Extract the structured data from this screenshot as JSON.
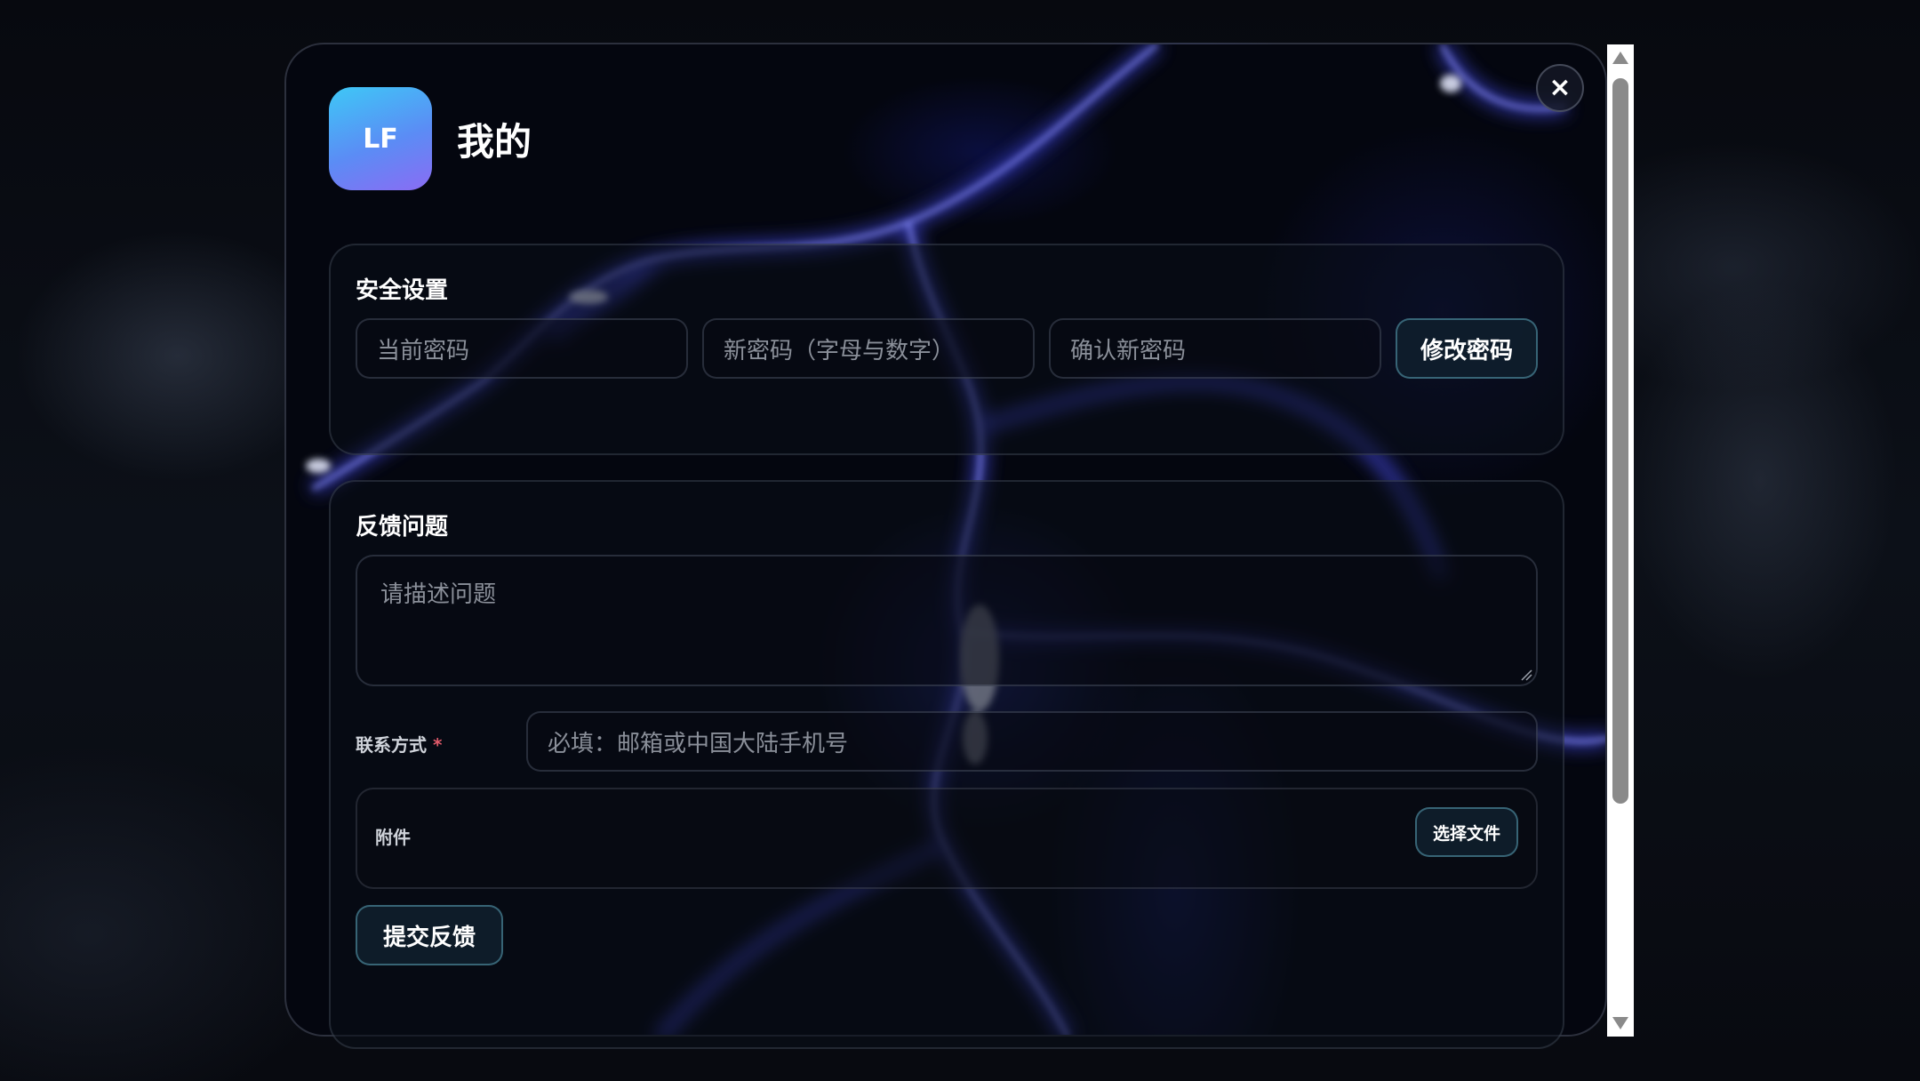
{
  "dialog": {
    "avatar_initials": "LF",
    "title": "我的",
    "close_icon": "×"
  },
  "security": {
    "title": "安全设置",
    "current_password_placeholder": "当前密码",
    "new_password_placeholder": "新密码（字母与数字）",
    "confirm_password_placeholder": "确认新密码",
    "change_password_label": "修改密码"
  },
  "feedback": {
    "title": "反馈问题",
    "description_placeholder": "请描述问题",
    "contact_label": "联系方式",
    "required_mark": "*",
    "contact_placeholder": "必填：邮箱或中国大陆手机号",
    "attachment_label": "附件",
    "choose_file_label": "选择文件",
    "submit_label": "提交反馈"
  },
  "theme": {
    "accent": "#5b8cf5",
    "avatar_gradient": [
      "#3ec8f6",
      "#8a6cf3"
    ],
    "lightning": "#4a4ff0",
    "required": "#e05a6a"
  }
}
